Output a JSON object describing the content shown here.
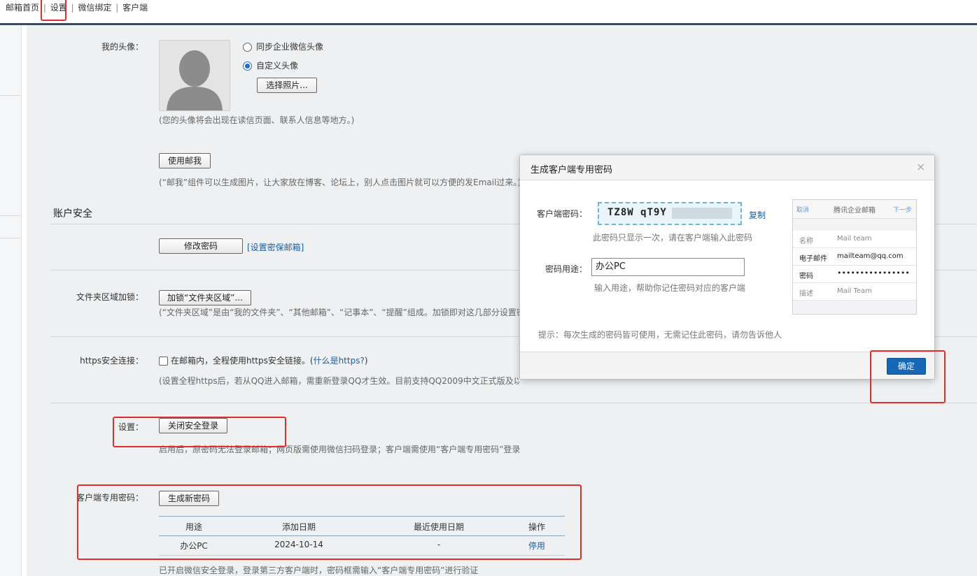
{
  "topnav": {
    "mail_home": "邮箱首页",
    "settings": "设置",
    "wechat_bind": "微信绑定",
    "client": "客户端",
    "separator": "|"
  },
  "avatar_section": {
    "label": "我的头像：",
    "option_sync": "同步企业微信头像",
    "option_custom": "自定义头像",
    "choose_photo": "选择照片...",
    "hint": "(您的头像将会出现在读信页面、联系人信息等地方。)"
  },
  "mailme": {
    "button": "使用邮我",
    "hint": "(“邮我”组件可以生成图片，让大家放在博客、论坛上，别人点击图片就可以方便的发Email过来。)"
  },
  "account_security": {
    "title": "账户安全",
    "change_password": "修改密码",
    "set_secure_email": "[设置密保邮箱]"
  },
  "folder_lock": {
    "label": "文件夹区域加锁：",
    "button": "加锁“文件夹区域”...",
    "hint": "(“文件夹区域”是由“我的文件夹”、“其他邮箱”、“记事本”、“提醒”组成。加锁即对这几部分设置密码"
  },
  "https": {
    "label": "https安全连接：",
    "checkbox_label": "在邮箱内，全程使用https安全链接。(",
    "what_is_link": "什么是https?",
    "close_paren": ")",
    "hint": "(设置全程https后，若从QQ进入邮箱，需重新登录QQ才生效。目前支持QQ2009中文正式版及以后版本。)"
  },
  "secure_login": {
    "label": "设置：",
    "button": "关闭安全登录",
    "hint": "启用后，原密码无法登录邮箱；网页版需使用微信扫码登录；客户端需使用“客户端专用密码”登录"
  },
  "client_password": {
    "label": "客户端专用密码：",
    "generate_button": "生成新密码",
    "table": {
      "headers": [
        "用途",
        "添加日期",
        "最近使用日期",
        "操作"
      ],
      "rows": [
        {
          "purpose": "办公PC",
          "added": "2024-10-14",
          "last_used": "-",
          "action": "停用"
        }
      ]
    },
    "hint": "已开启微信安全登录，登录第三方客户端时，密码框需输入“客户端专用密码”进行验证"
  },
  "modal": {
    "title": "生成客户端专用密码",
    "close": "×",
    "pwd_label": "客户端密码：",
    "pwd_value": "TZ8W qT9Y",
    "copy": "复制",
    "pwd_hint": "此密码只显示一次，请在客户端输入此密码",
    "usage_label": "密码用途：",
    "usage_value": "办公PC",
    "usage_hint": "输入用途，帮助你记住密码对应的客户端",
    "tip": "提示：每次生成的密码皆可使用，无需记住此密码，请勿告诉他人",
    "ok": "确定",
    "preview": {
      "cancel": "取消",
      "title": "腾讯企业邮箱",
      "next": "下一步",
      "rows": [
        {
          "k": "名称",
          "v": "Mail team"
        },
        {
          "k": "电子邮件",
          "v": "mailteam@qq.com"
        },
        {
          "k": "密码",
          "v": "••••••••••••••••"
        },
        {
          "k": "描述",
          "v": "Mail Team"
        }
      ]
    }
  },
  "colors": {
    "nav_line": "#2f4d6e",
    "annotation_red": "#e52b2b",
    "primary_button": "#1667b5",
    "link_blue": "#1a5fa8"
  }
}
